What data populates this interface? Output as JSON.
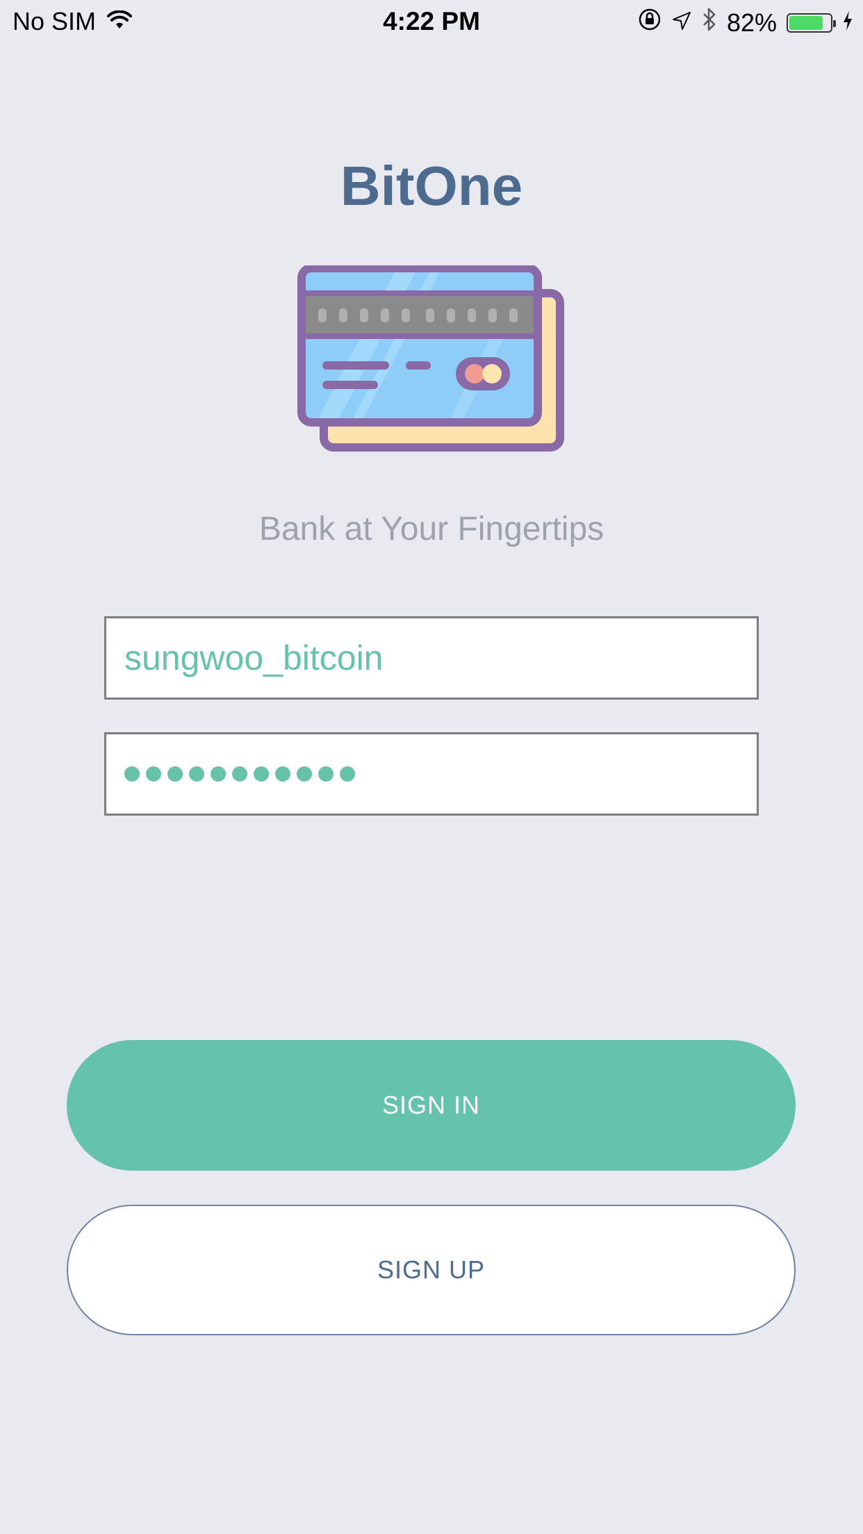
{
  "status_bar": {
    "carrier": "No SIM",
    "time": "4:22 PM",
    "battery_percent_text": "82%",
    "battery_level": 0.82,
    "icons": [
      "wifi-icon",
      "orientation-lock-icon",
      "location-icon",
      "bluetooth-icon",
      "battery-icon",
      "charging-icon"
    ]
  },
  "app": {
    "title": "BitOne",
    "tagline": "Bank at Your Fingertips",
    "illustration": "credit-cards-icon"
  },
  "form": {
    "username_value": "sungwoo_bitcoin",
    "password_length": 11
  },
  "buttons": {
    "sign_in": "SIGN IN",
    "sign_up": "SIGN UP"
  },
  "colors": {
    "background": "#e9e9f0",
    "title": "#4d6b8f",
    "accent": "#66c3ab",
    "tagline": "#9ea3ab",
    "card_blue": "#8ecdf7",
    "card_outline": "#8a6aa6",
    "card_back": "#fbe3ad"
  }
}
